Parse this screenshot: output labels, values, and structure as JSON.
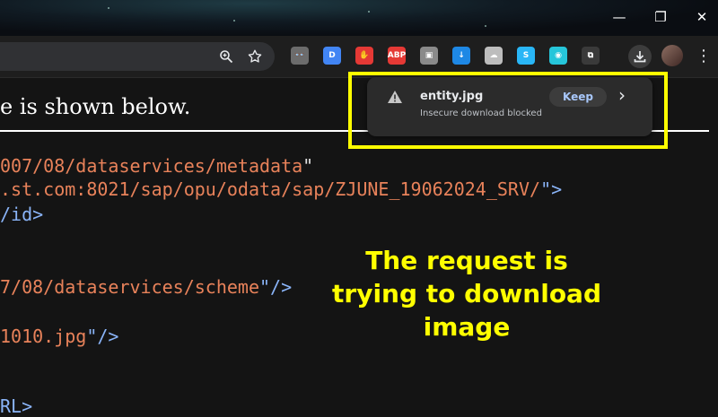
{
  "window": {
    "minimize_glyph": "—",
    "restore_glyph": "❐",
    "close_glyph": "✕"
  },
  "toolbar": {
    "zoom_icon": "zoom-icon",
    "bookmark_icon": "star-icon",
    "extensions": [
      {
        "name": "spy-extension-icon",
        "color": "#6c6c6c",
        "glyph": "👓"
      },
      {
        "name": "doc-extension-icon",
        "color": "#4285f4",
        "glyph": "D"
      },
      {
        "name": "stop-hand-extension-icon",
        "color": "#e53935",
        "glyph": "✋"
      },
      {
        "name": "abp-extension-icon",
        "color": "#e53935",
        "glyph": "ABP"
      },
      {
        "name": "screen-capture-extension-icon",
        "color": "#8a8a8a",
        "glyph": "▣"
      },
      {
        "name": "down-arrow-extension-icon",
        "color": "#1e88e5",
        "glyph": "↓"
      },
      {
        "name": "cloud-extension-icon",
        "color": "#bdbdbd",
        "glyph": "☁"
      },
      {
        "name": "s-extension-icon",
        "color": "#29b6f6",
        "glyph": "S"
      },
      {
        "name": "wifi-extension-icon",
        "color": "#26c6da",
        "glyph": "◉"
      },
      {
        "name": "puzzle-extensions-icon",
        "color": "#3a3a3a",
        "glyph": "⧉"
      }
    ],
    "download_icon": "download-icon",
    "menu_glyph": "⋮"
  },
  "page": {
    "heading": "e is shown below.",
    "code_lines": [
      {
        "parts": [
          {
            "text": "007/08/dataservices/metadata",
            "cls": "orange"
          },
          {
            "text": "\"",
            "cls": "white"
          }
        ]
      },
      {
        "parts": [
          {
            "text": ".st.com:8021/sap/opu/odata/sap/ZJUNE_19062024_SRV/",
            "cls": "orange"
          },
          {
            "text": "\">",
            "cls": "blue"
          }
        ]
      },
      {
        "parts": [
          {
            "text": "/id>",
            "cls": "blue"
          }
        ]
      },
      {
        "parts": [
          {
            "text": "7/08/dataservices/scheme",
            "cls": "orange"
          },
          {
            "text": "\"/>",
            "cls": "blue"
          }
        ]
      },
      {
        "parts": [
          {
            "text": "1010.jpg",
            "cls": "orange"
          },
          {
            "text": "\"/>",
            "cls": "blue"
          }
        ]
      },
      {
        "parts": [
          {
            "text": "RL>",
            "cls": "blue"
          }
        ]
      }
    ]
  },
  "download_popup": {
    "filename": "entity.jpg",
    "status": "Insecure download blocked",
    "keep_label": "Keep",
    "chevron": "›",
    "warning_icon": "warning-icon"
  },
  "annotation": {
    "line1": "The request is",
    "line2": "trying to download",
    "line3": "image",
    "color": "#ffff00"
  }
}
